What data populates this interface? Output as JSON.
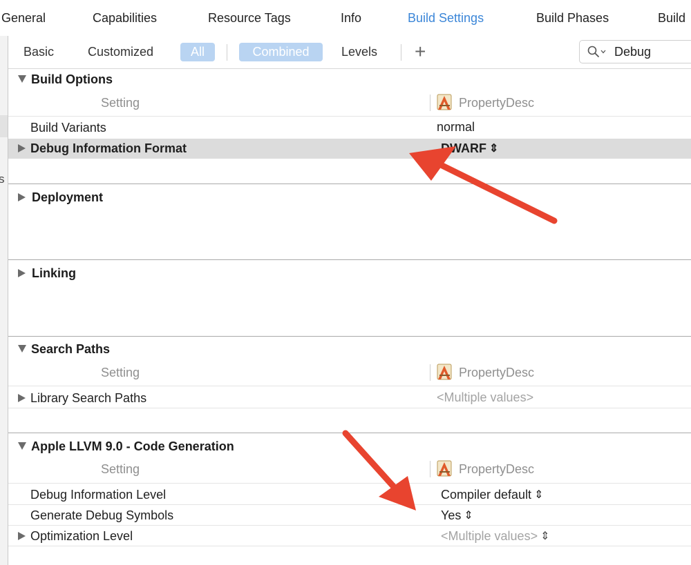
{
  "tabs": [
    "General",
    "Capabilities",
    "Resource Tags",
    "Info",
    "Build Settings",
    "Build Phases",
    "Build"
  ],
  "active_tab": "Build Settings",
  "filter_bar": {
    "basic": "Basic",
    "customized": "Customized",
    "all": "All",
    "combined": "Combined",
    "levels": "Levels",
    "add": "+",
    "search_value": "Debug"
  },
  "gutter": {
    "fragment": "s"
  },
  "column_headers": {
    "setting": "Setting",
    "target": "PropertyDesc"
  },
  "sections": {
    "build_options": {
      "title": "Build Options",
      "rows": [
        {
          "label": "Build Variants",
          "value": "normal"
        },
        {
          "label": "Debug Information Format",
          "value": "DWARF"
        }
      ]
    },
    "deployment": {
      "title": "Deployment"
    },
    "linking": {
      "title": "Linking"
    },
    "search_paths": {
      "title": "Search Paths",
      "rows": [
        {
          "label": "Library Search Paths",
          "value": "<Multiple values>"
        }
      ]
    },
    "code_generation": {
      "title": "Apple LLVM 9.0 - Code Generation",
      "rows": [
        {
          "label": "Debug Information Level",
          "value": "Compiler default"
        },
        {
          "label": "Generate Debug Symbols",
          "value": "Yes"
        },
        {
          "label": "Optimization Level",
          "value": "<Multiple values>"
        }
      ]
    }
  },
  "colors": {
    "accent": "#3b86d8",
    "pill": "#b9d4f2",
    "annotation_arrow": "#e8442f",
    "row_highlight": "#dcdcdc"
  },
  "icons": [
    "magnifier-icon",
    "chevron-down-icon",
    "disclosure-triangle-icon",
    "xcode-target-icon",
    "stepper-icon"
  ]
}
